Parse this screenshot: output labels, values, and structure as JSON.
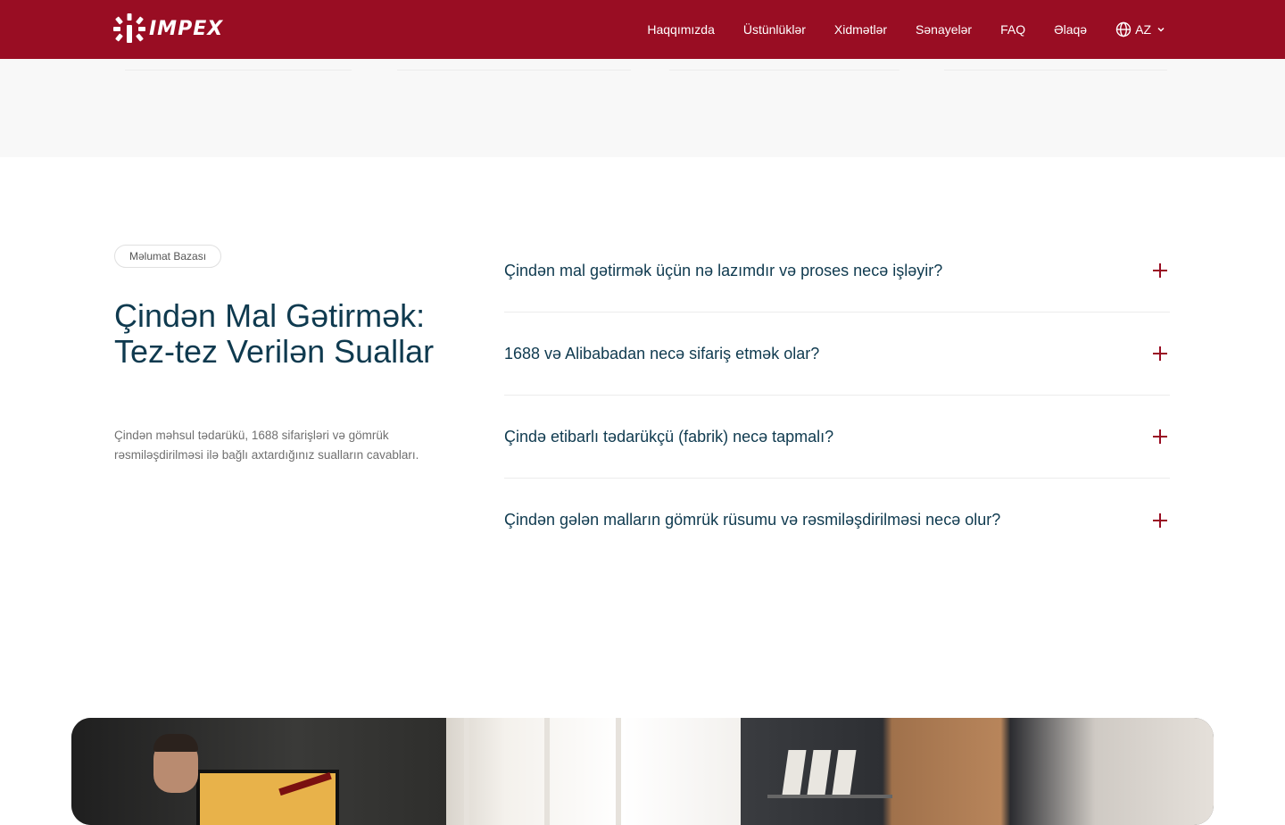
{
  "brand": {
    "name": "IMPEX",
    "color": "#990d23",
    "text_color": "#0f3a4f"
  },
  "nav": {
    "items": [
      "Haqqımızda",
      "Üstünlüklər",
      "Xidmətlər",
      "Sənayelər",
      "FAQ",
      "Əlaqə"
    ],
    "language": {
      "label": "AZ",
      "icon": "globe-icon"
    }
  },
  "faq": {
    "badge": "Məlumat Bazası",
    "title": "Çindən Mal Gətirmək: Tez-tez Verilən Suallar",
    "description": "Çindən məhsul tədarükü, 1688 sifarişləri və gömrük rəsmiləşdirilməsi ilə bağlı axtardığınız sualların cavabları.",
    "questions": [
      "Çindən mal gətirmək üçün nə lazımdır və proses necə işləyir?",
      "1688 və Alibabadan necə sifariş etmək olar?",
      "Çində etibarlı tədarükçü (fabrik) necə tapmalı?",
      "Çindən gələn malların gömrük rüsumu və rəsmiləşdirilməsi necə olur?"
    ]
  }
}
